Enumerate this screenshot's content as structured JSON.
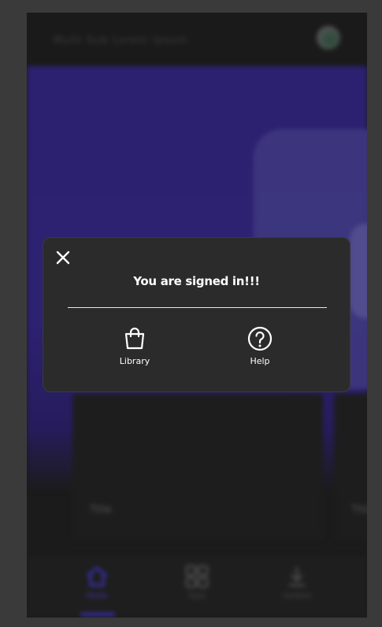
{
  "header": {
    "title": "Multi Sub Lorem Ipsum"
  },
  "cards": [
    {
      "title": "Title"
    },
    {
      "title": "Title"
    }
  ],
  "bottom_nav": [
    {
      "label": "Home",
      "icon": "home-icon",
      "active": true
    },
    {
      "label": "Apps",
      "icon": "apps-icon",
      "active": false
    },
    {
      "label": "Updates",
      "icon": "download-icon",
      "active": false
    }
  ],
  "dialog": {
    "message": "You are signed in!!!",
    "actions": [
      {
        "label": "Library",
        "icon": "shopping-bag-icon"
      },
      {
        "label": "Help",
        "icon": "help-circle-icon"
      }
    ]
  },
  "colors": {
    "accent": "#3a2eb0",
    "hero": "#2c2070",
    "dialog_bg": "#2b2b2b"
  }
}
